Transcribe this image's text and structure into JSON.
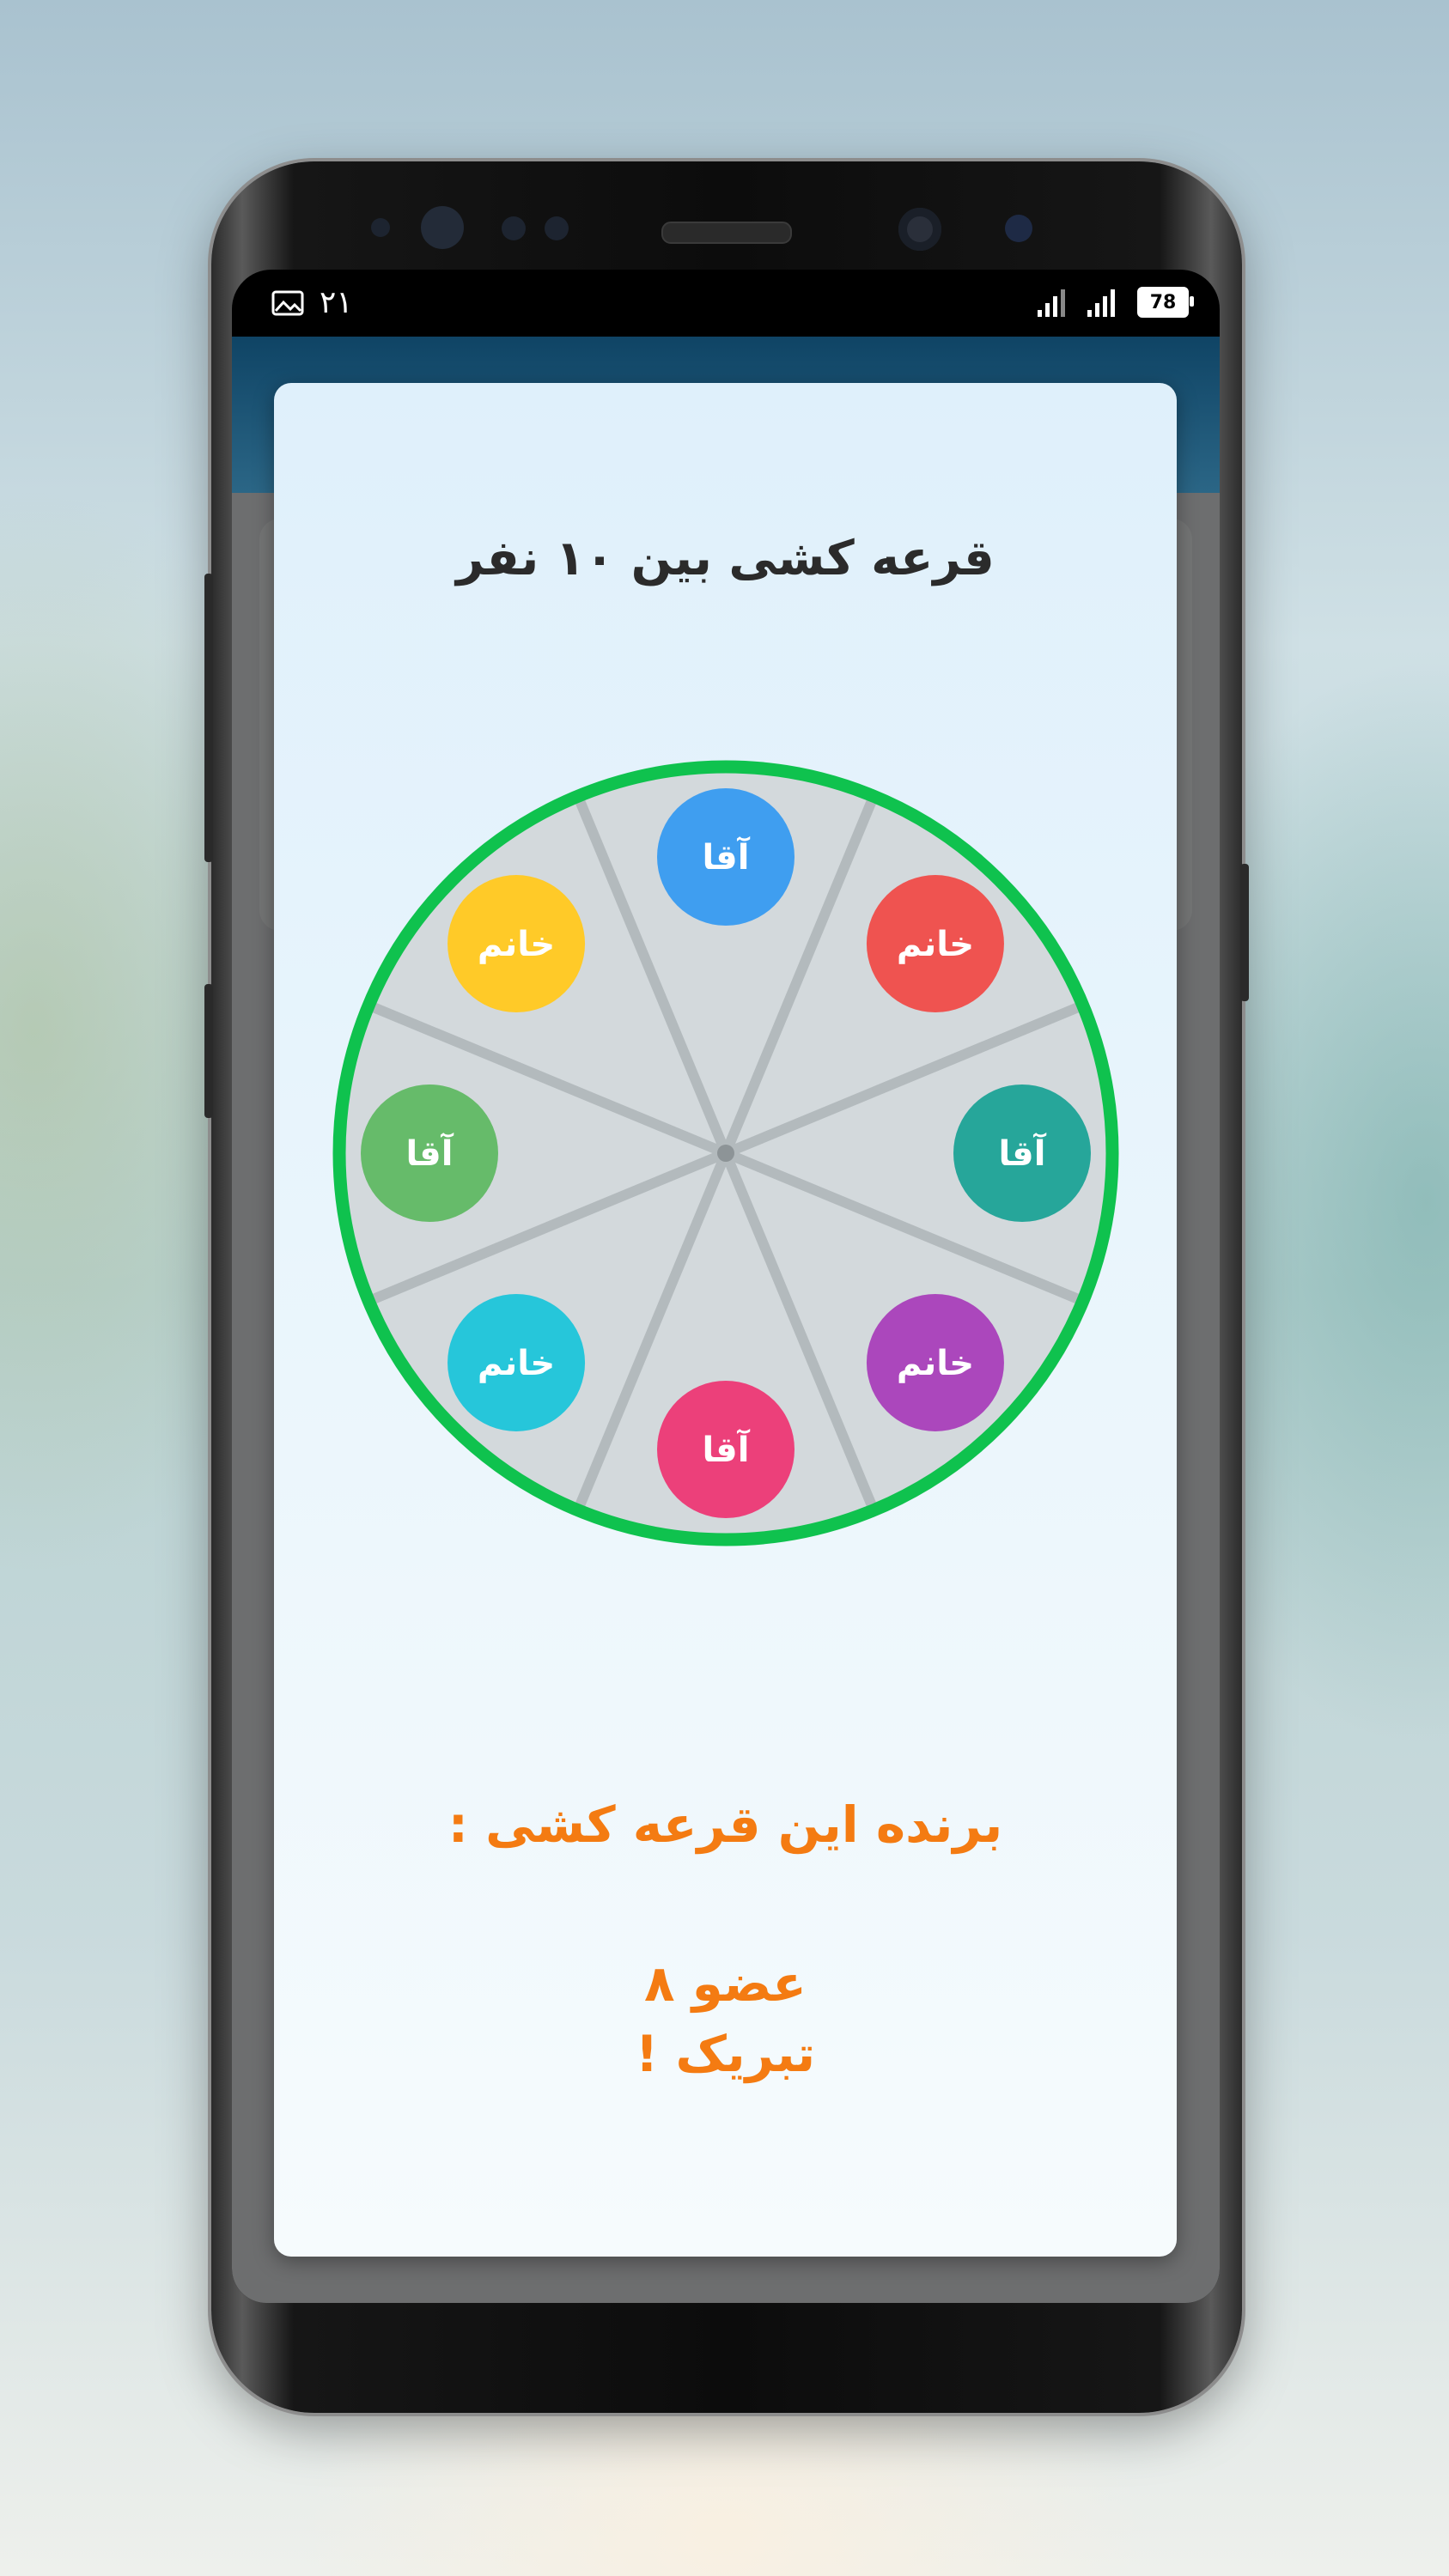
{
  "status_bar": {
    "time": "۲۱",
    "battery": "78"
  },
  "dialog": {
    "title": "قرعه کشی بین ۱۰ نفر",
    "result_heading": "برنده این قرعه کشی :",
    "winner": "عضو ۸",
    "congrats": "تبریک !"
  },
  "wheel": {
    "rim_color": "#0fc24e",
    "face_color": "#d3d9dc",
    "members": [
      {
        "label": "آقا",
        "color": "#3f9ef0"
      },
      {
        "label": "خانم",
        "color": "#ef5350"
      },
      {
        "label": "آقا",
        "color": "#26a69a"
      },
      {
        "label": "خانم",
        "color": "#ab47bc"
      },
      {
        "label": "آقا",
        "color": "#ec407a"
      },
      {
        "label": "خانم",
        "color": "#26c6da"
      },
      {
        "label": "آقا",
        "color": "#66bb6a"
      },
      {
        "label": "خانم",
        "color": "#ffca28"
      }
    ]
  }
}
